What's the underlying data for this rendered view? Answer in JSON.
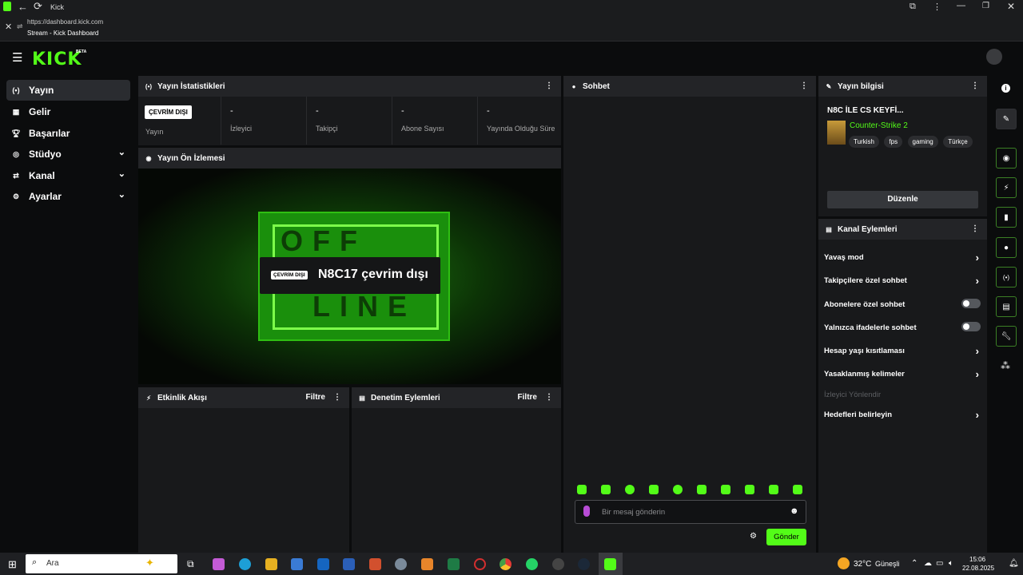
{
  "browser": {
    "tab_title": "Kick",
    "url": "https://dashboard.kick.com",
    "page_title": "Stream - Kick Dashboard"
  },
  "app": {
    "logo": "KICK",
    "beta": "BETA"
  },
  "sidebar": {
    "items": [
      {
        "label": "Yayın",
        "icon": "broadcast-icon",
        "active": true
      },
      {
        "label": "Gelir",
        "icon": "revenue-icon"
      },
      {
        "label": "Başarılar",
        "icon": "trophy-icon"
      },
      {
        "label": "Stüdyo",
        "icon": "studio-icon",
        "expandable": true
      },
      {
        "label": "Kanal",
        "icon": "channel-icon",
        "expandable": true
      },
      {
        "label": "Ayarlar",
        "icon": "gear-icon",
        "expandable": true
      }
    ]
  },
  "stats": {
    "title": "Yayın İstatistikleri",
    "status_badge": "ÇEVRİM DIŞI",
    "status_label": "Yayın",
    "cells": [
      {
        "value": "-",
        "label": "İzleyici"
      },
      {
        "value": "-",
        "label": "Takipçi"
      },
      {
        "value": "-",
        "label": "Abone Sayısı"
      },
      {
        "value": "-",
        "label": "Yayında Olduğu Süre"
      }
    ]
  },
  "preview": {
    "title": "Yayın Ön İzlemesi",
    "badge": "ÇEVRİM DIŞI",
    "message": "N8C17 çevrim dışı",
    "sign_top": "OFF",
    "sign_bottom": "LINE"
  },
  "activity": {
    "title": "Etkinlik Akışı",
    "filter": "Filtre"
  },
  "moderation": {
    "title": "Denetim Eylemleri",
    "filter": "Filtre"
  },
  "chat": {
    "title": "Sohbet",
    "placeholder": "Bir mesaj gönderin",
    "send": "Gönder"
  },
  "stream_info": {
    "title": "Yayın bilgisi",
    "stream_title": "N8C İLE CS KEYFİ...",
    "category": "Counter-Strike 2",
    "tags": [
      "Turkish",
      "fps",
      "gaming",
      "Türkçe"
    ],
    "edit": "Düzenle"
  },
  "channel_actions": {
    "title": "Kanal Eylemleri",
    "items": [
      {
        "label": "Yavaş mod",
        "control": "arrow"
      },
      {
        "label": "Takipçilere özel sohbet",
        "control": "arrow"
      },
      {
        "label": "Abonelere özel sohbet",
        "control": "toggle"
      },
      {
        "label": "Yalnızca ifadelerle sohbet",
        "control": "toggle"
      },
      {
        "label": "Hesap yaşı kısıtlaması",
        "control": "arrow"
      },
      {
        "label": "Yasaklanmış kelimeler",
        "control": "arrow"
      },
      {
        "label": "İzleyici Yönlendir",
        "control": "none",
        "disabled": true
      },
      {
        "label": "Hedefleri belirleyin",
        "control": "arrow"
      }
    ]
  },
  "taskbar": {
    "search_placeholder": "Ara",
    "weather": "32°C",
    "weather_desc": "Güneşli",
    "time": "15:06",
    "date": "22.08.2025"
  },
  "colors": {
    "accent": "#53fc18",
    "panel": "#18191b",
    "panel_header": "#232427"
  }
}
